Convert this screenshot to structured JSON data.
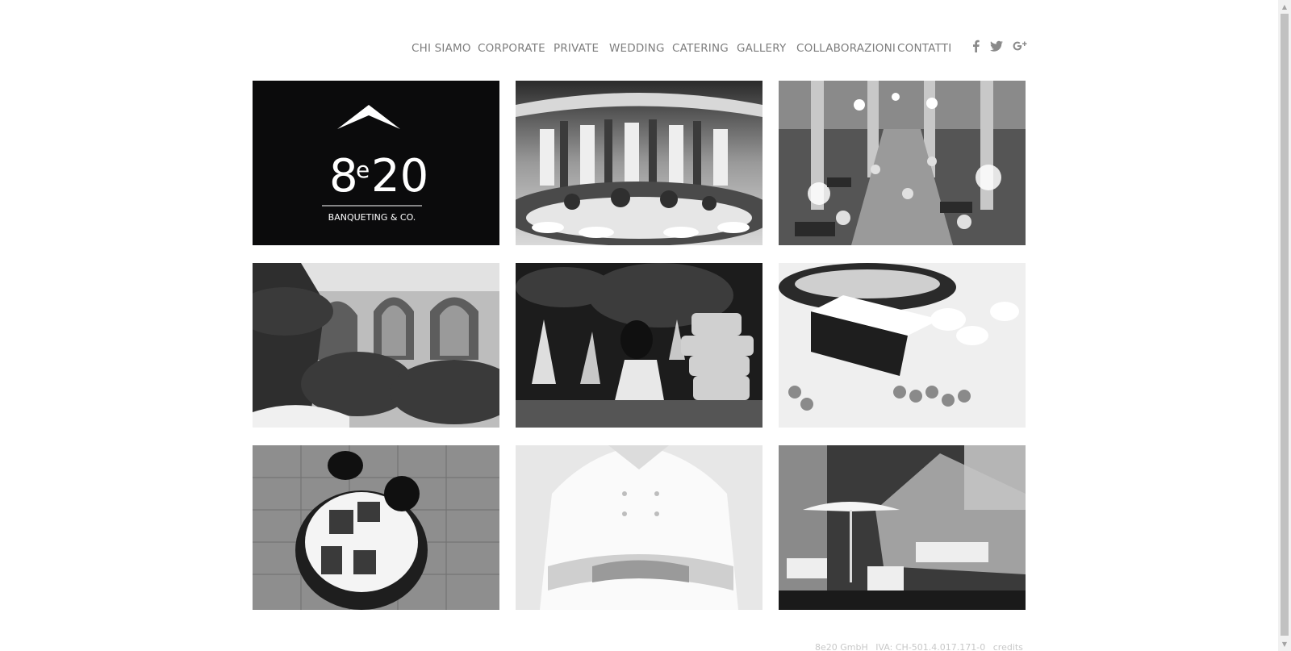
{
  "nav": {
    "items": [
      {
        "label": "CHI SIAMO"
      },
      {
        "label": "CORPORATE"
      },
      {
        "label": "PRIVATE"
      },
      {
        "label": "WEDDING"
      },
      {
        "label": "CATERING"
      },
      {
        "label": "GALLERY"
      },
      {
        "label": "COLLABORAZIONI"
      },
      {
        "label": "CONTATTI"
      }
    ],
    "social": [
      "facebook-icon",
      "twitter-icon",
      "google-plus-icon"
    ]
  },
  "logo": {
    "number_left": "8",
    "letter": "e",
    "number_right": "20",
    "tagline": "BANQUETING & CO."
  },
  "gallery": [
    "ballroom-dinner-photo",
    "hall-with-chandeliers-photo",
    "arched-windows-garden-photo",
    "wedding-cake-fireworks-photo",
    "dessert-buffet-photo",
    "staff-setting-table-photo",
    "chef-arms-crossed-photo",
    "outdoor-tent-terrace-photo"
  ],
  "footer": {
    "company": "8e20 GmbH",
    "vat": "IVA: CH-501.4.017.171-0",
    "credits": "credits"
  },
  "colors": {
    "nav_text": "#7d7d7d",
    "logo_bg": "#0b0b0c",
    "footer_text": "#c8c8c8"
  }
}
